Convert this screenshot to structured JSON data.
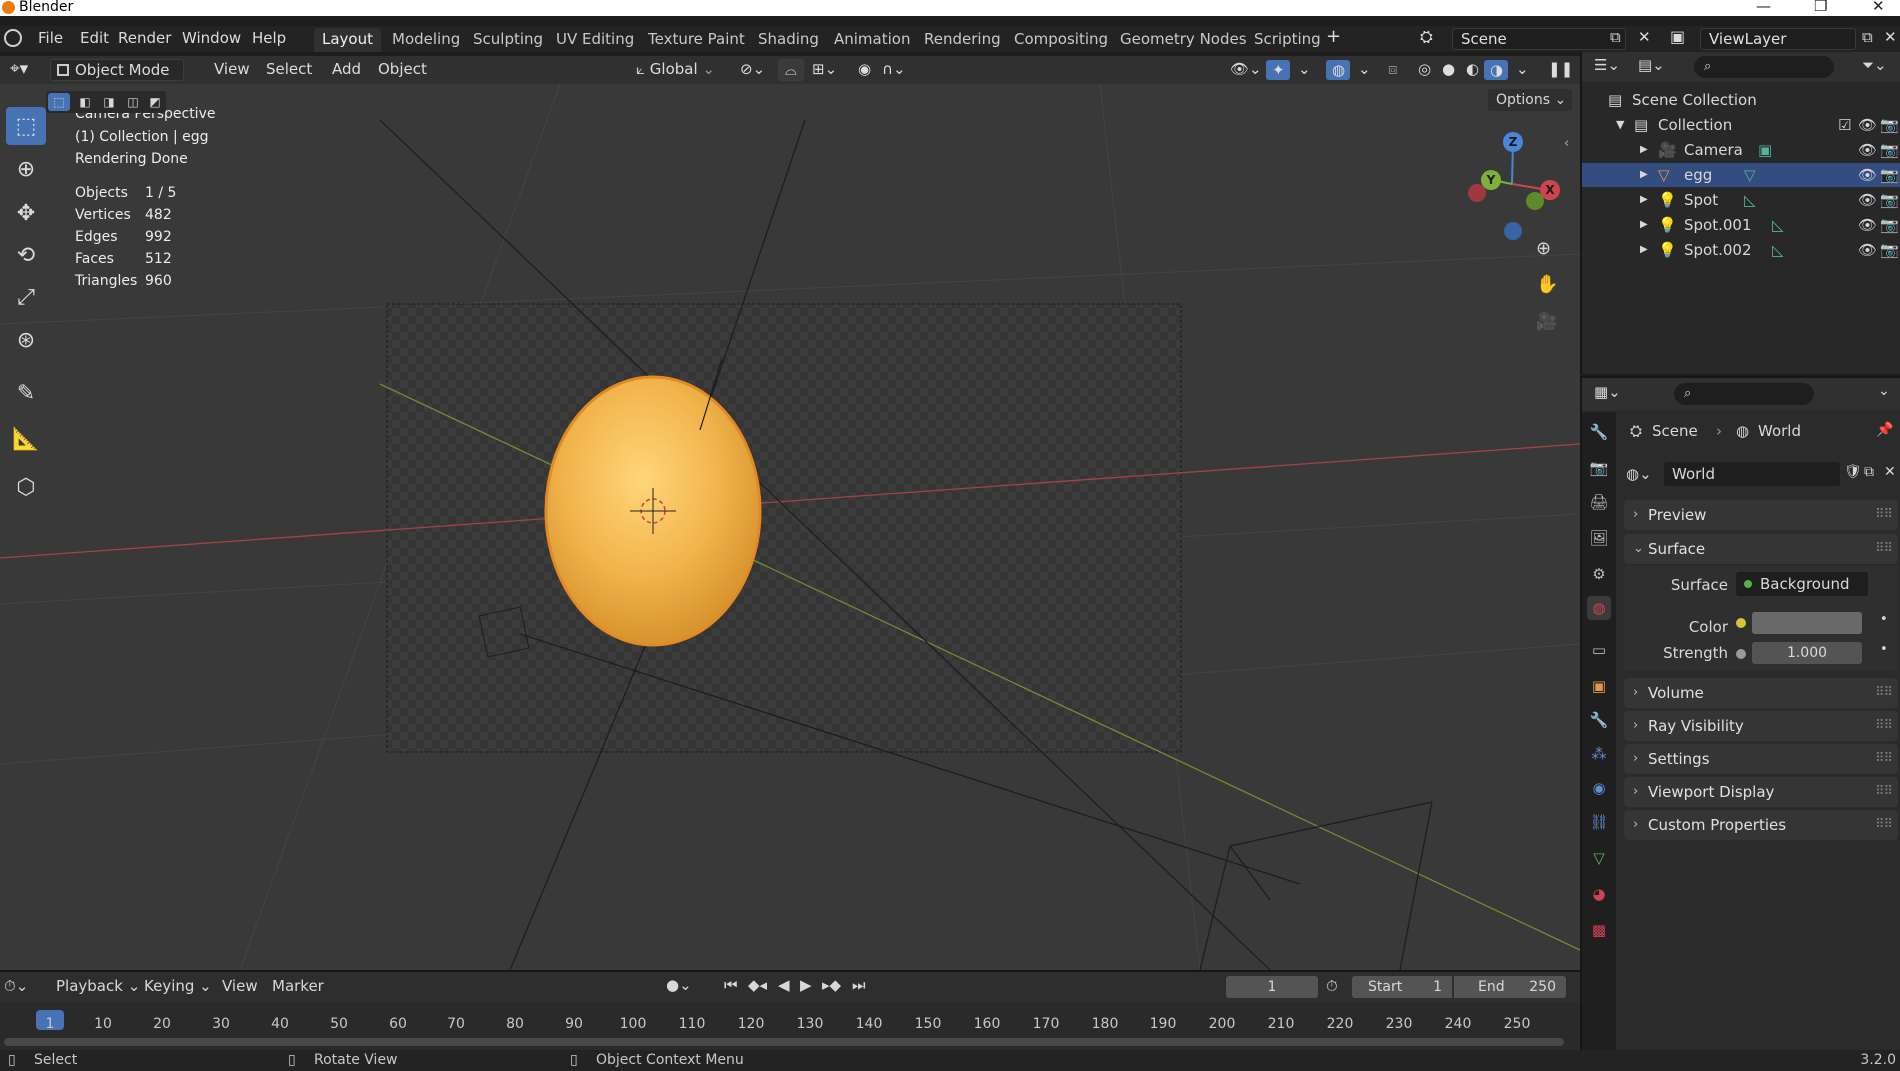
{
  "window": {
    "title": "Blender"
  },
  "topbar": {
    "menus": [
      "File",
      "Edit",
      "Render",
      "Window",
      "Help"
    ],
    "workspaces": [
      "Layout",
      "Modeling",
      "Sculpting",
      "UV Editing",
      "Texture Paint",
      "Shading",
      "Animation",
      "Rendering",
      "Compositing",
      "Geometry Nodes",
      "Scripting"
    ],
    "active_workspace": "Layout",
    "scene": "Scene",
    "view_layer": "ViewLayer"
  },
  "viewport_header": {
    "mode": "Object Mode",
    "menus": [
      "View",
      "Select",
      "Add",
      "Object"
    ],
    "orientation": "Global",
    "options": "Options"
  },
  "viewport": {
    "camera_info": "Camera Perspective",
    "collection_info": "(1) Collection | egg",
    "render_status": "Rendering Done",
    "stats": [
      {
        "label": "Objects",
        "value": "1 / 5"
      },
      {
        "label": "Vertices",
        "value": "482"
      },
      {
        "label": "Edges",
        "value": "992"
      },
      {
        "label": "Faces",
        "value": "512"
      },
      {
        "label": "Triangles",
        "value": "960"
      }
    ],
    "gizmo": {
      "x": "X",
      "y": "Y",
      "z": "Z"
    }
  },
  "outliner": {
    "root": "Scene Collection",
    "collection": "Collection",
    "items": [
      {
        "name": "Camera",
        "selected": false
      },
      {
        "name": "egg",
        "selected": true
      },
      {
        "name": "Spot",
        "selected": false
      },
      {
        "name": "Spot.001",
        "selected": false
      },
      {
        "name": "Spot.002",
        "selected": false
      }
    ]
  },
  "properties": {
    "breadcrumb_scene": "Scene",
    "breadcrumb_world": "World",
    "world_name": "World",
    "panels_top": [
      "Preview",
      "Surface"
    ],
    "surface_label": "Surface",
    "surface_value": "Background",
    "color_label": "Color",
    "strength_label": "Strength",
    "strength_value": "1.000",
    "panels_bottom": [
      "Volume",
      "Ray Visibility",
      "Settings",
      "Viewport Display",
      "Custom Properties"
    ]
  },
  "timeline": {
    "menus": [
      "Playback",
      "Keying",
      "View",
      "Marker"
    ],
    "current_frame": "1",
    "start_label": "Start",
    "start_value": "1",
    "end_label": "End",
    "end_value": "250",
    "ruler": [
      "1",
      "10",
      "20",
      "30",
      "40",
      "50",
      "60",
      "70",
      "80",
      "90",
      "100",
      "110",
      "120",
      "130",
      "140",
      "150",
      "160",
      "170",
      "180",
      "190",
      "200",
      "210",
      "220",
      "230",
      "240",
      "250"
    ]
  },
  "statusbar": {
    "select": "Select",
    "rotate": "Rotate View",
    "context": "Object Context Menu",
    "version": "3.2.0"
  },
  "colors": {
    "accent": "#4772b3",
    "egg": "#f0b24a",
    "x_axis": "#d1434f",
    "y_axis": "#7fb13a",
    "z_axis": "#4a86d8"
  }
}
